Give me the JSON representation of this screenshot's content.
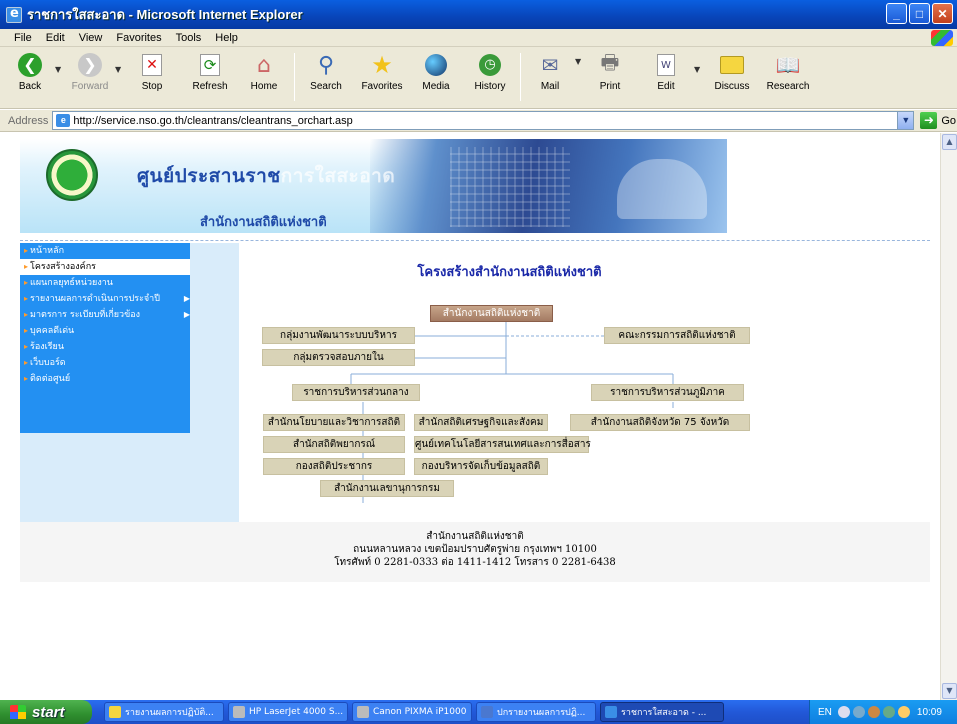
{
  "window": {
    "title": "ราชการใสสะอาด - Microsoft Internet Explorer"
  },
  "menubar": [
    "File",
    "Edit",
    "View",
    "Favorites",
    "Tools",
    "Help"
  ],
  "toolbar": [
    {
      "label": "Back",
      "icon": "back-arrow-icon"
    },
    {
      "label": "Forward",
      "icon": "forward-arrow-icon"
    },
    {
      "label": "Stop",
      "icon": "stop-icon"
    },
    {
      "label": "Refresh",
      "icon": "refresh-icon"
    },
    {
      "label": "Home",
      "icon": "home-icon"
    },
    {
      "label": "Search",
      "icon": "search-icon"
    },
    {
      "label": "Favorites",
      "icon": "star-icon"
    },
    {
      "label": "Media",
      "icon": "media-icon"
    },
    {
      "label": "History",
      "icon": "history-icon"
    },
    {
      "label": "Mail",
      "icon": "mail-icon"
    },
    {
      "label": "Print",
      "icon": "printer-icon"
    },
    {
      "label": "Edit",
      "icon": "edit-icon"
    },
    {
      "label": "Discuss",
      "icon": "discuss-icon"
    },
    {
      "label": "Research",
      "icon": "research-icon"
    }
  ],
  "address": {
    "label": "Address",
    "url": "http://service.nso.go.th/cleantrans/cleantrans_orchart.asp",
    "go": "Go"
  },
  "banner": {
    "title_main": "ศูนย์ประสานราช",
    "title_fade": "การใสสะอาด",
    "subtitle": "สำนักงานสถิติแห่งชาติ"
  },
  "nav": [
    {
      "label": "หน้าหลัก",
      "selected": false,
      "submenu": false
    },
    {
      "label": "โครงสร้างองค์กร",
      "selected": true,
      "submenu": false
    },
    {
      "label": "แผนกลยุทธ์หน่วยงาน",
      "selected": false,
      "submenu": false
    },
    {
      "label": "รายงานผลการดำเนินการประจำปี",
      "selected": false,
      "submenu": true
    },
    {
      "label": "มาตรการ ระเบียบที่เกี่ยวข้อง",
      "selected": false,
      "submenu": true
    },
    {
      "label": "บุคคลดีเด่น",
      "selected": false,
      "submenu": false
    },
    {
      "label": "ร้องเรียน",
      "selected": false,
      "submenu": false
    },
    {
      "label": "เว็บบอร์ด",
      "selected": false,
      "submenu": false
    },
    {
      "label": "ติดต่อศูนย์",
      "selected": false,
      "submenu": false
    }
  ],
  "org": {
    "title": "โครงสร้างสำนักงานสถิติแห่งชาติ",
    "top": "สำนักงานสถิติแห่งชาติ",
    "left_units": [
      "กลุ่มงานพัฒนาระบบบริหาร",
      "กลุ่มตรวจสอบภายใน"
    ],
    "committee": "คณะกรรมการสถิติแห่งชาติ",
    "central": "ราชการบริหารส่วนกลาง",
    "regional": "ราชการบริหารส่วนภูมิภาค",
    "central_units": [
      "สำนักนโยบายและวิชาการสถิติ",
      "สำนักสถิติเศรษฐกิจและสังคม",
      "สำนักสถิติพยากรณ์",
      "ศูนย์เทคโนโลยีสารสนเทศและการสื่อสาร",
      "กองสถิติประชากร",
      "กองบริหารจัดเก็บข้อมูลสถิติ",
      "สำนักงานเลขานุการกรม"
    ],
    "regional_unit": "สำนักงานสถิติจังหวัด 75 จังหวัด"
  },
  "footer": {
    "line1": "สำนักงานสถิติแห่งชาติ",
    "line2": "ถนนหลานหลวง เขตป้อมปราบศัตรูพ่าย กรุงเทพฯ 10100",
    "line3": "โทรศัพท์ 0 2281-0333 ต่อ 1411-1412 โทรสาร 0 2281-6438"
  },
  "taskbar": {
    "start": "start",
    "tasks": [
      {
        "label": "รายงานผลการปฏิบัติ...",
        "active": false
      },
      {
        "label": "HP LaserJet 4000 S...",
        "active": false
      },
      {
        "label": "Canon PIXMA iP1000",
        "active": false
      },
      {
        "label": "ปกรายงานผลการปฏิ...",
        "active": false
      },
      {
        "label": "ราชการใสสะอาด - ...",
        "active": true
      }
    ],
    "lang": "EN",
    "clock": "10:09"
  }
}
